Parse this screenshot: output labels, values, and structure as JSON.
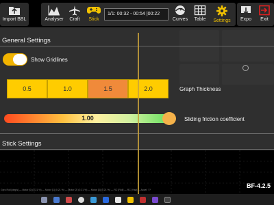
{
  "toolbar": {
    "import_label": "Import BBL",
    "analyser_label": "Analyser",
    "craft_label": "Craft",
    "stick_label": "Stick",
    "time_range": "1/1: 00:32 - 00:54 |00:22",
    "curves_label": "Curves",
    "table_label": "Table",
    "settings_label": "Settings",
    "export_label": "Expo",
    "exit_label": "Exit"
  },
  "general_settings": {
    "title": "General Settings",
    "show_gridlines_label": "Show Gridlines",
    "show_gridlines_on": true,
    "thickness_options": [
      "0.5",
      "1.0",
      "1.5",
      "2.0"
    ],
    "thickness_selected": "1.5",
    "graph_thickness_label": "Graph Thickness",
    "friction_value": "1.00",
    "friction_label": "Sliding friction coefficient"
  },
  "stick_settings": {
    "title": "Stick Settings"
  },
  "graph": {
    "legend": "Gyro Roll [deg/s] — Motor [0] (0.21 %) — Motor [1] (0.21 %) — Motor [2] (0.21 %) — Motor [3] (0.21 %) — RC [Roll] — RC [Yaw] — Accel: ??",
    "version": "BF-4.2.5"
  },
  "colors": {
    "accent": "#f2c200",
    "thickness_button": "#ffcc00",
    "thickness_selected": "#f08a3a",
    "exit_icon": "#e02020"
  }
}
